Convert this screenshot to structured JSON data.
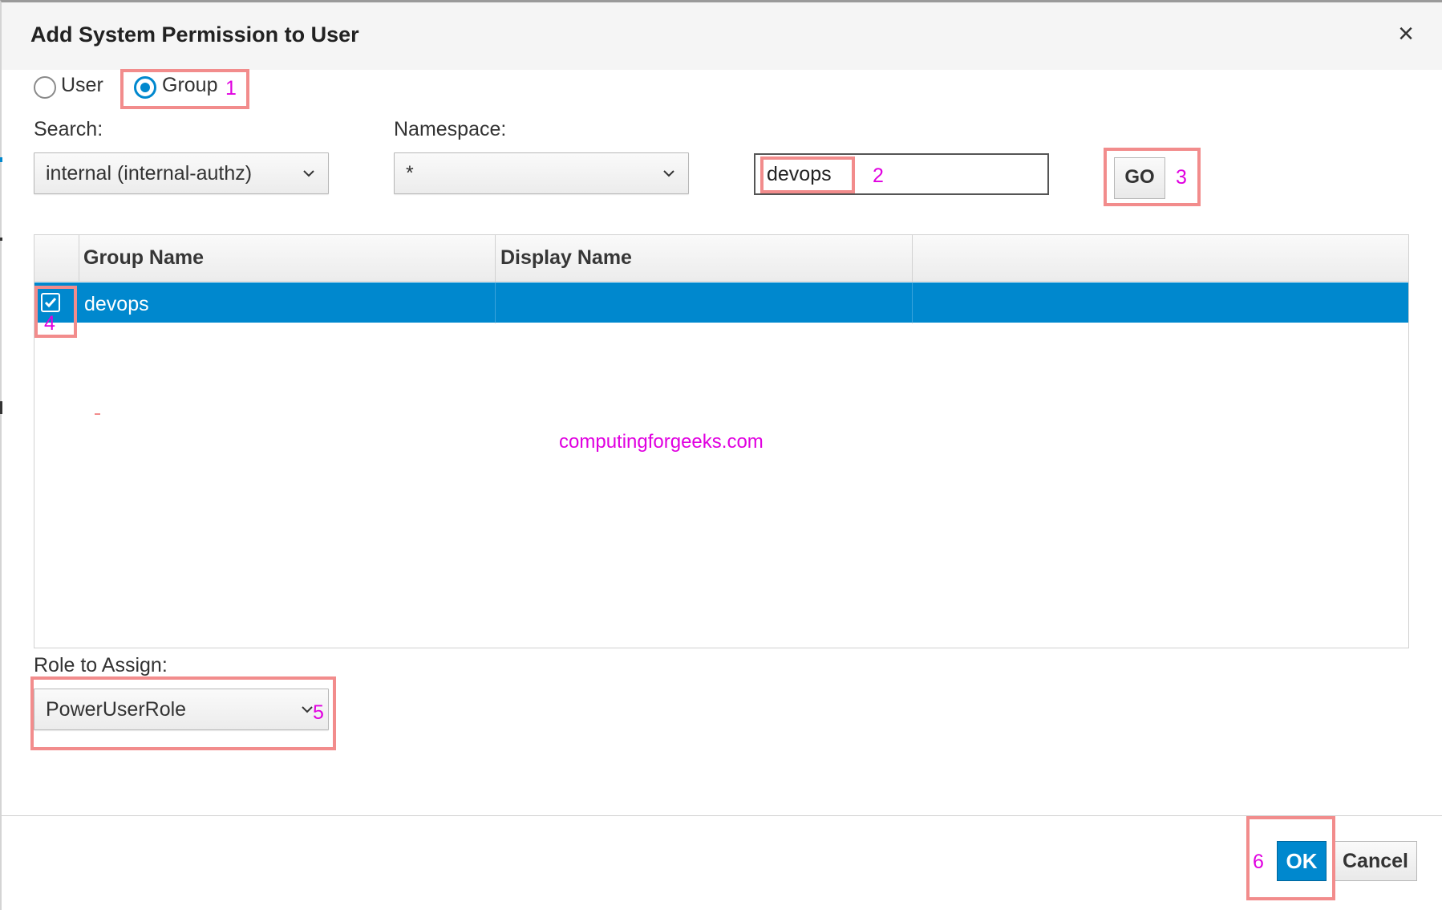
{
  "dialog": {
    "title": "Add System Permission to User",
    "close_glyph": "×"
  },
  "principal_type": {
    "options": [
      {
        "label": "User",
        "selected": false
      },
      {
        "label": "Group",
        "selected": true
      }
    ]
  },
  "search": {
    "label": "Search:",
    "selected": "internal (internal-authz)"
  },
  "namespace": {
    "label": "Namespace:",
    "selected": "*"
  },
  "query": {
    "value": "devops"
  },
  "go_label": "GO",
  "table": {
    "columns": [
      "Group Name",
      "Display Name",
      ""
    ],
    "rows": [
      {
        "checked": true,
        "group_name": "devops",
        "display_name": ""
      }
    ]
  },
  "role": {
    "label": "Role to Assign:",
    "selected": "PowerUserRole"
  },
  "footer": {
    "ok_label": "OK",
    "cancel_label": "Cancel"
  },
  "watermark": "computingforgeeks.com",
  "annotations": [
    "1",
    "2",
    "3",
    "4",
    "5",
    "6"
  ],
  "colors": {
    "primary": "#0088ce",
    "highlight_box": "#f28c8c",
    "annotation_text": "#e000e0",
    "header_bg": "#f5f5f5"
  },
  "icons": {
    "close": "close-icon",
    "dropdown": "chevron-down-icon",
    "checkbox": "check-icon"
  }
}
